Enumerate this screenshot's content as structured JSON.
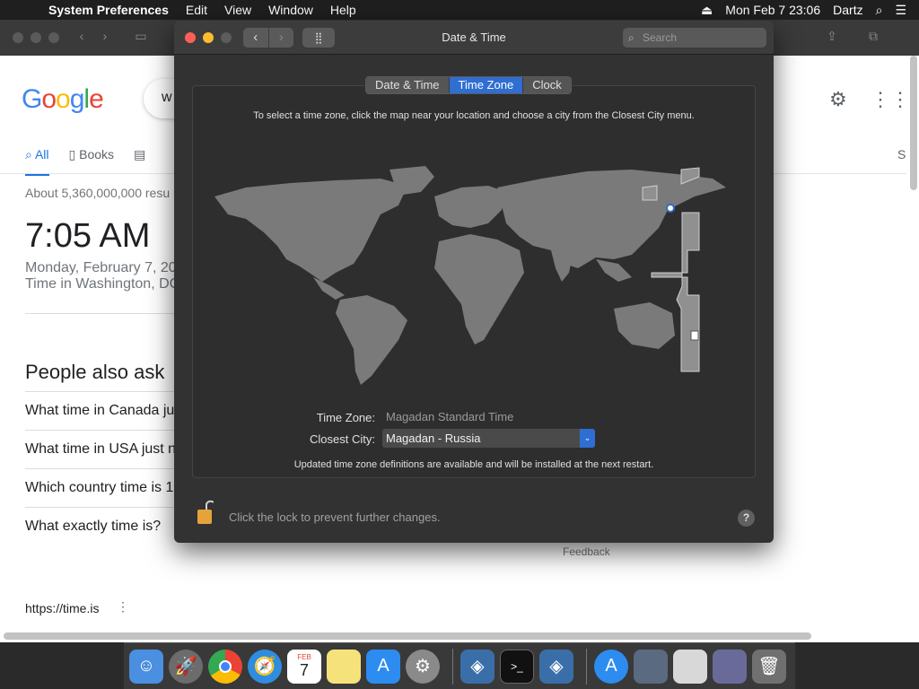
{
  "menubar": {
    "app_name": "System Preferences",
    "items": [
      "Edit",
      "View",
      "Window",
      "Help"
    ],
    "clock": "Mon Feb 7  23:06",
    "user": "Dartz"
  },
  "browser": {
    "search_partial": "w",
    "tabs": [
      "All",
      "Books",
      "S"
    ],
    "about_results": "About 5,360,000,000 resu",
    "time": "7:05 AM",
    "date_line": "Monday, February 7, 20",
    "location_line": "Time in Washington, DC",
    "people_also_ask": "People also ask",
    "questions": [
      "What time in Canada ju",
      "What time in USA just n",
      "Which country time is 1",
      "What exactly time is?"
    ],
    "feedback": "Feedback",
    "result_url": "https://time.is"
  },
  "prefs": {
    "window_title": "Date & Time",
    "search_placeholder": "Search",
    "tabs": [
      "Date & Time",
      "Time Zone",
      "Clock"
    ],
    "selected_tab": "Time Zone",
    "instruction": "To select a time zone, click the map near your location and choose a city from the Closest City menu.",
    "time_zone_label": "Time Zone:",
    "time_zone_value": "Magadan Standard Time",
    "closest_city_label": "Closest City:",
    "closest_city_value": "Magadan - Russia",
    "update_note": "Updated time zone definitions are available and will be installed at the next restart.",
    "lock_text": "Click the lock to prevent further changes.",
    "help_symbol": "?",
    "accent": "#2f6ed3"
  },
  "dock": {
    "apps": [
      "finder-icon",
      "launchpad-icon",
      "chrome-icon",
      "safari-icon",
      "calendar-icon",
      "notes-icon",
      "app-store-icon",
      "system-preferences-icon",
      "virtualbox-icon",
      "terminal-icon",
      "virtualbox-vm-icon",
      "app-store-download-icon",
      "window-preview-icon",
      "window-preview-icon",
      "window-preview-icon",
      "trash-icon"
    ],
    "calendar_month": "FEB",
    "calendar_day": "7"
  }
}
